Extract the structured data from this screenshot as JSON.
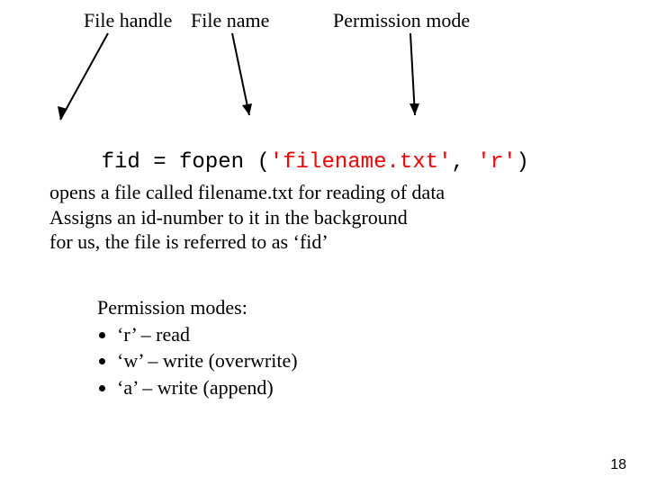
{
  "labels": {
    "file_handle": "File handle",
    "file_name": "File name",
    "permission_mode": "Permission mode"
  },
  "code": {
    "prefix": "fid = fopen (",
    "filename": "'filename.txt'",
    "comma": ", ",
    "mode": "'r'",
    "suffix": ")"
  },
  "explanation": {
    "line1": "opens a file called filename.txt for reading of data",
    "line2": "Assigns an id-number to it in the background",
    "line3": "for us, the file is referred to as ‘fid’"
  },
  "modes": {
    "heading": "Permission modes:",
    "items": [
      "‘r’  – read",
      "‘w’ – write (overwrite)",
      "‘a’ – write (append)"
    ]
  },
  "page_number": "18"
}
